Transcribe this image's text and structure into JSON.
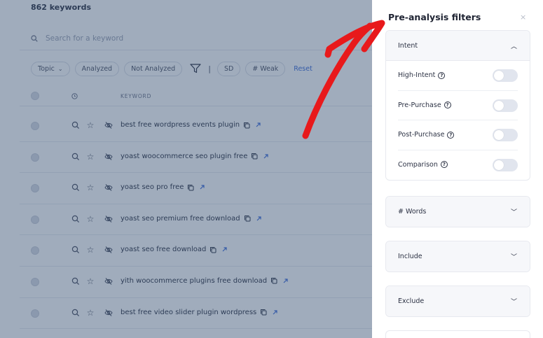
{
  "main": {
    "keyword_count": "862 keywords",
    "search_placeholder": "Search for a keyword",
    "filters": {
      "topic": "Topic",
      "analyzed": "Analyzed",
      "not_analyzed": "Not Analyzed",
      "separator": "|",
      "sd": "SD",
      "weak": "# Weak",
      "reset": "Reset"
    },
    "table": {
      "keyword_header": "KEYWORD",
      "rows": [
        {
          "keyword": "best free wordpress events plugin"
        },
        {
          "keyword": "yoast woocommerce seo plugin free"
        },
        {
          "keyword": "yoast seo pro free"
        },
        {
          "keyword": "yoast seo premium free download"
        },
        {
          "keyword": "yoast seo free download"
        },
        {
          "keyword": "yith woocommerce plugins free download"
        },
        {
          "keyword": "best free video slider plugin wordpress"
        }
      ]
    }
  },
  "drawer": {
    "title": "Pre-analysis filters",
    "close": "×",
    "sections": [
      {
        "label": "Intent",
        "expanded": true,
        "options": [
          {
            "label": "High-Intent",
            "on": false
          },
          {
            "label": "Pre-Purchase",
            "on": false
          },
          {
            "label": "Post-Purchase",
            "on": false
          },
          {
            "label": "Comparison",
            "on": false
          }
        ]
      },
      {
        "label": "# Words",
        "expanded": false
      },
      {
        "label": "Include",
        "expanded": false
      },
      {
        "label": "Exclude",
        "expanded": false
      }
    ]
  },
  "annotation": {
    "color": "#e8191b"
  }
}
